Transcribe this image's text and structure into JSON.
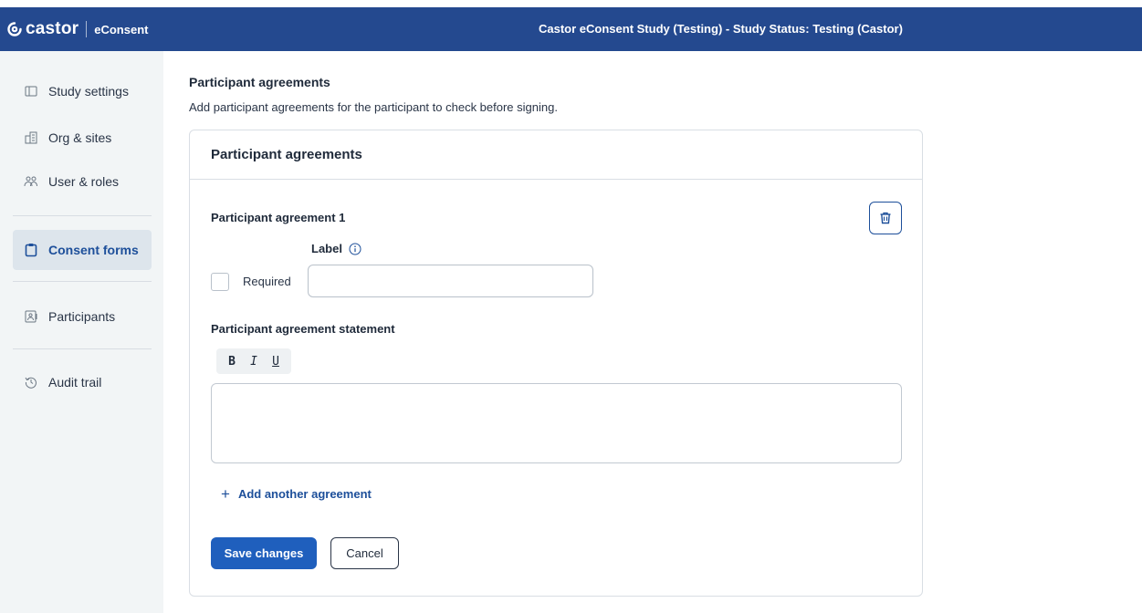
{
  "header": {
    "brand_name": "castor",
    "product_name": "eConsent",
    "study_title": "Castor eConsent Study (Testing)  - Study Status: Testing (Castor)",
    "brand_color": "#24498f"
  },
  "sidebar": {
    "items": [
      {
        "label": "Study settings",
        "icon": "settings-page-icon",
        "active": false
      },
      {
        "label": "Org & sites",
        "icon": "buildings-icon",
        "active": false
      },
      {
        "label": "User & roles",
        "icon": "users-icon",
        "active": false
      },
      {
        "label": "Consent forms",
        "icon": "clipboard-icon",
        "active": true
      },
      {
        "label": "Participants",
        "icon": "participants-icon",
        "active": false
      },
      {
        "label": "Audit trail",
        "icon": "history-icon",
        "active": false
      }
    ]
  },
  "main": {
    "title": "Participant agreements",
    "subtitle": "Add participant agreements for the participant to check before signing.",
    "card": {
      "header": "Participant agreements",
      "agreement_title": "Participant agreement 1",
      "label_field_label": "Label",
      "label_value": "",
      "required_label": "Required",
      "required_checked": false,
      "statement_label": "Participant agreement statement",
      "toolbar": {
        "bold": "B",
        "italic": "I",
        "underline": "U"
      },
      "statement_value": "",
      "add_agreement_label": "Add another agreement",
      "save_label": "Save changes",
      "cancel_label": "Cancel"
    }
  },
  "colors": {
    "accent": "#1f5fbd",
    "link": "#1d4f9a",
    "sidebar_bg": "#f2f5f6",
    "active_item_bg": "#dde5ec"
  }
}
